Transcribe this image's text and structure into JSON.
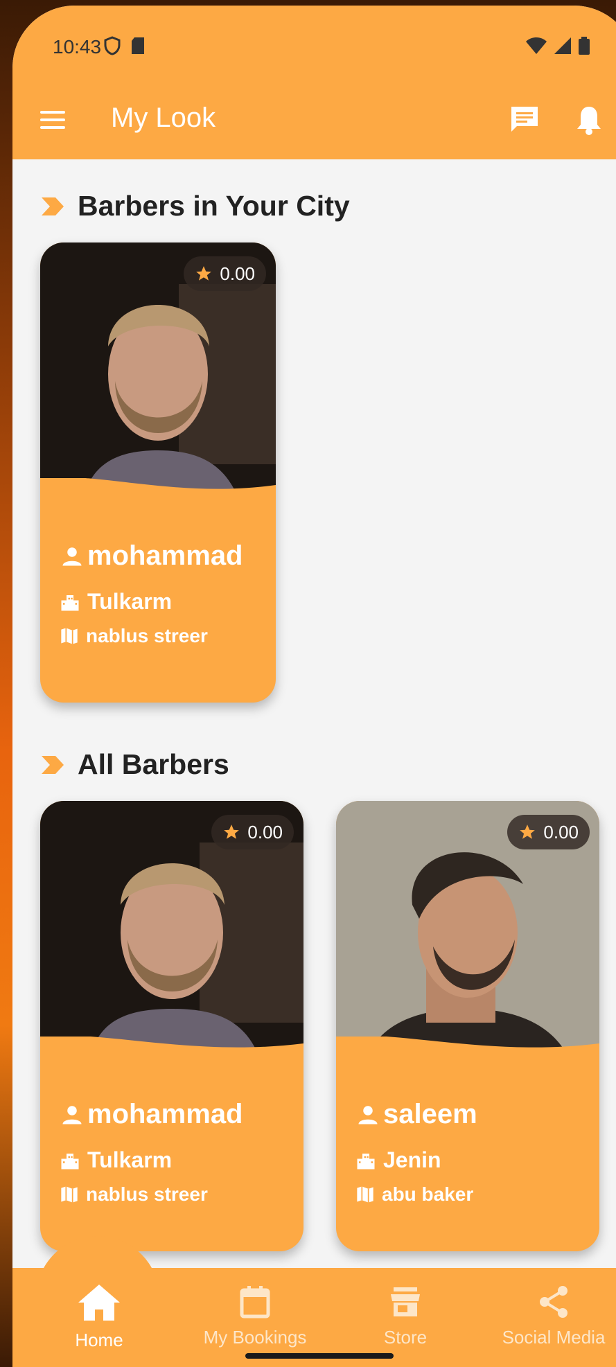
{
  "status_bar": {
    "time": "10:43"
  },
  "app_bar": {
    "title": "My Look"
  },
  "sections": {
    "city": {
      "title": "Barbers in Your City"
    },
    "all": {
      "title": "All Barbers"
    }
  },
  "city_cards": [
    {
      "rating": "0.00",
      "name": "mohammad",
      "city": "Tulkarm",
      "street": "nablus streer"
    }
  ],
  "all_cards": [
    {
      "rating": "0.00",
      "name": "mohammad",
      "city": "Tulkarm",
      "street": "nablus streer"
    },
    {
      "rating": "0.00",
      "name": "saleem",
      "city": "Jenin",
      "street": "abu baker"
    }
  ],
  "nav": {
    "home": "Home",
    "bookings": "My Bookings",
    "store": "Store",
    "social": "Social Media"
  },
  "colors": {
    "accent": "#fda944",
    "background": "#f4f4f4",
    "text": "#222222"
  },
  "icons": [
    "menu-icon",
    "chat-icon",
    "bell-icon",
    "star-icon",
    "person-icon",
    "city-icon",
    "map-icon",
    "home-icon",
    "calendar-icon",
    "store-icon",
    "share-icon"
  ]
}
